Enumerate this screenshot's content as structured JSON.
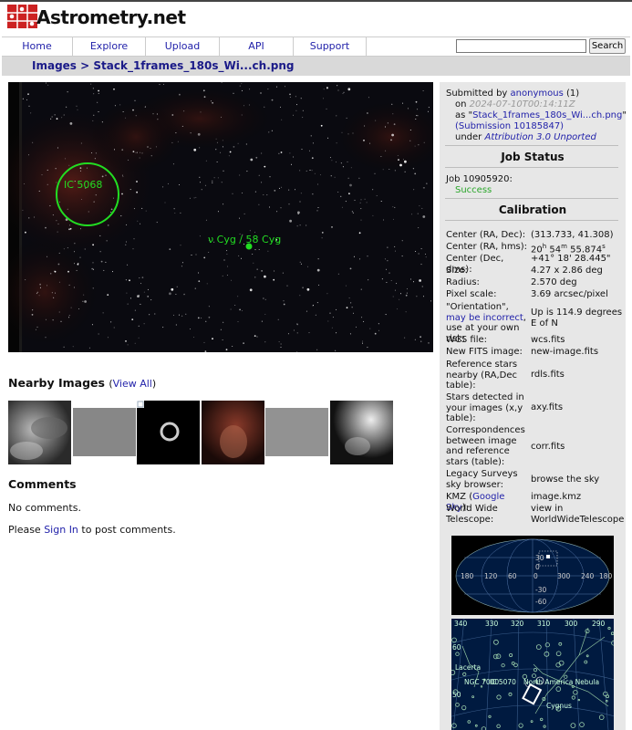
{
  "header": {
    "logo_text": "Astrometry.net"
  },
  "nav": {
    "items": [
      "Home",
      "Explore",
      "Upload",
      "API",
      "Support"
    ],
    "search_button": "Search"
  },
  "breadcrumb": {
    "root": "Images",
    "separator": ">",
    "current": "Stack_1frames_180s_Wi...ch.png"
  },
  "image": {
    "annotations": [
      {
        "label": "IC 5068",
        "kind": "circle"
      },
      {
        "label": "ν Cyg / 58 Cyg",
        "kind": "star"
      }
    ]
  },
  "nearby": {
    "title": "Nearby Images",
    "view_all_open": "(",
    "view_all": "View All",
    "view_all_close": ")"
  },
  "comments": {
    "title": "Comments",
    "none": "No comments.",
    "please": "Please",
    "sign_in": "Sign In",
    "post": "to post comments."
  },
  "submission": {
    "submitted_by": "Submitted by",
    "user": "anonymous",
    "user_count": "(1)",
    "on": "on",
    "date": "2024-07-10T00:14:11Z",
    "as_open": "as \"",
    "filename": "Stack_1frames_180s_Wi...ch.png",
    "as_close": "\"",
    "submission_link": "(Submission 10185847)",
    "under": "under",
    "license": "Attribution 3.0 Unported"
  },
  "job_status": {
    "title": "Job Status",
    "job": "Job 10905920:",
    "status": "Success",
    "status_color": "#2aa62a"
  },
  "calibration": {
    "title": "Calibration",
    "rows": [
      {
        "label": "Center (RA, Dec):",
        "value": "(313.733, 41.308)"
      },
      {
        "label": "Center (RA, hms):",
        "value": "20h 54m 55.874s"
      },
      {
        "label": "Center (Dec, dms):",
        "value": "+41° 18' 28.445\""
      },
      {
        "label": "Size:",
        "value": "4.27 x 2.86 deg"
      },
      {
        "label": "Radius:",
        "value": "2.570 deg"
      },
      {
        "label": "Pixel scale:",
        "value": "3.69 arcsec/pixel"
      },
      {
        "label": "\"Orientation\", may be incorrect, use at your own risk:",
        "value": "Up is 114.9 degrees E of N"
      },
      {
        "label": "WCS file:",
        "value": "wcs.fits"
      },
      {
        "label": "New FITS image:",
        "value": "new-image.fits"
      },
      {
        "label": "Reference stars nearby (RA,Dec table):",
        "value": "rdls.fits"
      },
      {
        "label": "Stars detected in your images (x,y table):",
        "value": "axy.fits"
      },
      {
        "label": "Correspondences between image and reference stars (table):",
        "value": "corr.fits"
      },
      {
        "label": "Legacy Surveys sky browser:",
        "value": "browse the sky"
      },
      {
        "label": "KMZ (Google Sky):",
        "value": "image.kmz"
      },
      {
        "label": "World Wide Telescope:",
        "value": "view in WorldWideTelescope"
      }
    ],
    "ra_parts": {
      "h": "20",
      "h_unit": "h",
      "m": "54",
      "m_unit": "m",
      "s": "55.874",
      "s_unit": "s"
    },
    "orientation_parts": {
      "q1": "\"Orientation\",",
      "link": "may be incorrect",
      "rest": ", use at your own risk:"
    },
    "kmz_parts": {
      "pre": "KMZ (",
      "link": "Google Sky",
      "post": "):"
    }
  },
  "allsky_map": {
    "ra_labels": [
      "180",
      "120",
      "60",
      "0",
      "300",
      "240",
      "180"
    ],
    "dec_labels": [
      "30",
      "0",
      "-30",
      "-60"
    ]
  },
  "zoom_map": {
    "ra_labels": [
      "340",
      "330",
      "320",
      "310",
      "300",
      "290"
    ],
    "dec_labels": [
      "60",
      "50"
    ],
    "constellation_labels": [
      "Lacerta",
      "Cygnus"
    ],
    "object_labels": [
      "NGC 7000",
      "IC 5070",
      "North America Nebula"
    ]
  },
  "colors": {
    "link": "#2222aa",
    "annotation": "#22dd22",
    "sidebar_bg": "#e7e7e7",
    "breadcrumb_bg": "#d9d9d9"
  }
}
